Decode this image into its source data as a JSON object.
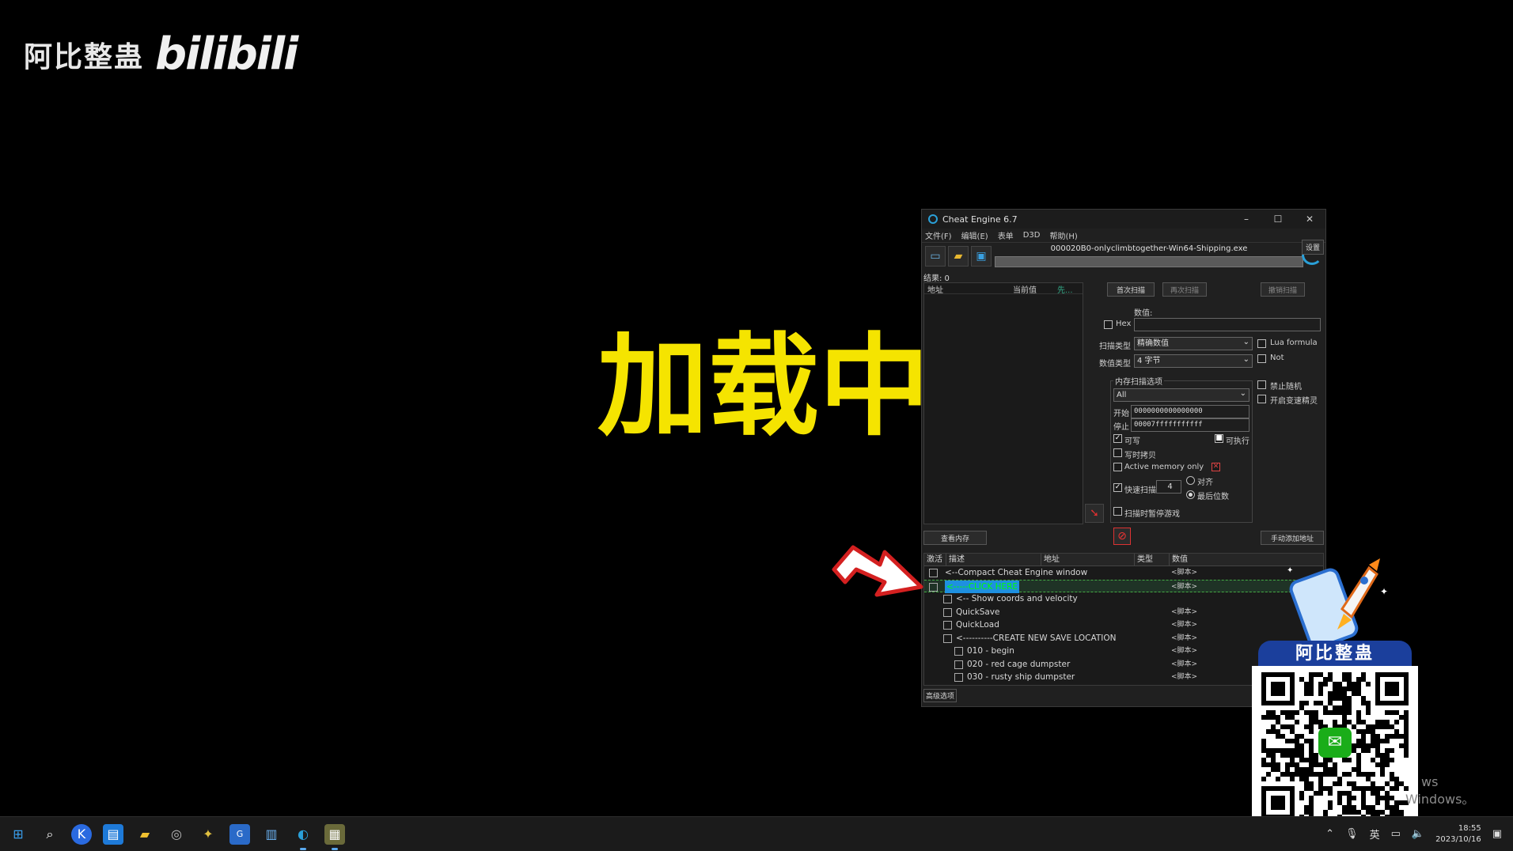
{
  "watermark": {
    "text": "阿比整蛊",
    "logo": "bilibili"
  },
  "overlay_text": "加载中",
  "ce": {
    "title": "Cheat Engine 6.7",
    "menu": [
      "文件(F)",
      "编辑(E)",
      "表单",
      "D3D",
      "帮助(H)"
    ],
    "process": "000020B0-onlyclimbtogether-Win64-Shipping.exe",
    "settings_label": "设置",
    "found_label": "结果: 0",
    "results_headers": [
      "地址",
      "当前值",
      "先..."
    ],
    "first_scan": "首次扫描",
    "next_scan": "再次扫描",
    "undo_scan": "撤销扫描",
    "value_label": "数值:",
    "hex_label": "Hex",
    "scan_type_label": "扫描类型",
    "scan_type_value": "精确数值",
    "value_type_label": "数值类型",
    "value_type_value": "4 字节",
    "lua_formula": "Lua formula",
    "not_label": "Not",
    "mem_options_title": "内存扫描选项",
    "mem_region": "All",
    "start_label": "开始",
    "start_value": "0000000000000000",
    "stop_label": "停止",
    "stop_value": "00007fffffffffff",
    "writable": "可写",
    "executable": "可执行",
    "copy_on_write": "写时拷贝",
    "active_memory_only": "Active memory only",
    "fast_scan": "快速扫描",
    "fast_scan_value": "4",
    "align": "对齐",
    "last_digits": "最后位数",
    "pause_game": "扫描时暂停游戏",
    "no_random": "禁止随机",
    "speedhack": "开启变速精灵",
    "view_memory": "查看内存",
    "add_manually": "手动添加地址",
    "table_headers": [
      "激活",
      "描述",
      "地址",
      "类型",
      "数值"
    ],
    "rows": [
      {
        "desc": "<--Compact Cheat Engine window",
        "value": "<脚本>",
        "indent": 0,
        "selected": false
      },
      {
        "desc": "<-----CLICK HERE",
        "value": "<脚本>",
        "indent": 0,
        "selected": true
      },
      {
        "desc": "<-- Show coords and velocity",
        "value": "",
        "indent": 1,
        "selected": false
      },
      {
        "desc": "QuickSave",
        "value": "<脚本>",
        "indent": 1,
        "selected": false
      },
      {
        "desc": "QuickLoad",
        "value": "<脚本>",
        "indent": 1,
        "selected": false
      },
      {
        "desc": "<----------CREATE NEW SAVE LOCATION",
        "value": "<脚本>",
        "indent": 1,
        "selected": false
      },
      {
        "desc": "010 - begin",
        "value": "<脚本>",
        "indent": 2,
        "selected": false
      },
      {
        "desc": "020 - red cage dumpster",
        "value": "<脚本>",
        "indent": 2,
        "selected": false
      },
      {
        "desc": "030 - rusty ship dumpster",
        "value": "<脚本>",
        "indent": 2,
        "selected": false
      }
    ],
    "advanced_options": "高级选项"
  },
  "promo": {
    "title": "阿比整蛊"
  },
  "windows_watermark": [
    "ws",
    "Windows。"
  ],
  "taskbar": {
    "apps": [
      "start-icon",
      "search-icon",
      "k-app-icon",
      "store-icon",
      "folder-icon",
      "chrome-icon",
      "tool-icon",
      "game-icon",
      "notepad-icon",
      "cheat-engine-icon",
      "image-app-icon"
    ],
    "ime": "英",
    "time": "18:55",
    "date": "2023/10/16"
  }
}
